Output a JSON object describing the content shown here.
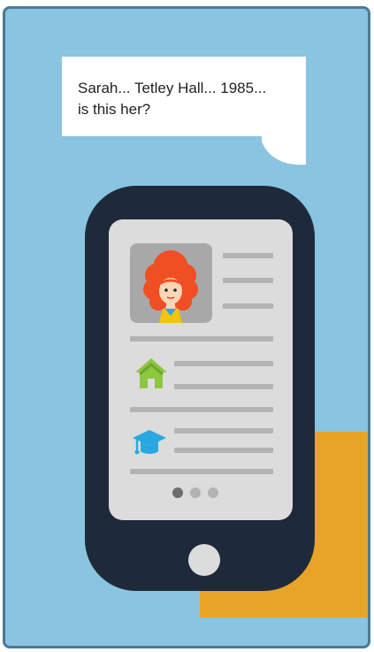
{
  "speech_bubble": {
    "text": "Sarah... Tetley Hall... 1985...\nis this her?"
  },
  "phone_screen": {
    "profile_icon": "red-haired-girl-avatar",
    "home_icon": "house-icon",
    "education_icon": "graduation-cap-icon",
    "pager": {
      "page_count": 3,
      "active_page": 1
    }
  },
  "colors": {
    "background": "#89c4e1",
    "panel_border": "#4a7a96",
    "accent_block": "#e8a427",
    "phone_body": "#1e2a3a",
    "screen": "#dcdcdc",
    "placeholder_line": "#b3b3b3",
    "home_icon": "#8dc63f",
    "education_icon": "#29a8e0",
    "hair": "#f04e23",
    "dot_active": "#6d6d6d",
    "dot_inactive": "#b3b3b3"
  }
}
